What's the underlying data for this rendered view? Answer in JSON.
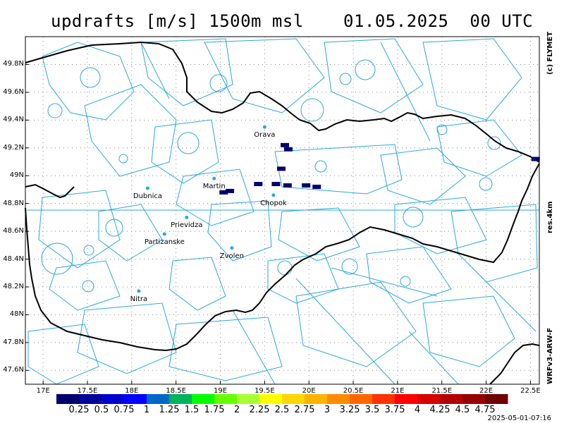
{
  "title": {
    "variable": "updrafts [m/s] 1500m msl",
    "datetime": "01.05.2025  00 UTC"
  },
  "side_labels": {
    "copyright": "(c) FLYMET",
    "resolution": "res.4km",
    "model": "WRFv3-ARW-F"
  },
  "timestamp": "2025-05-01-07:16",
  "map": {
    "lon_range": [
      16.8,
      22.6
    ],
    "lat_range": [
      47.5,
      50.0
    ],
    "lat_ticks": [
      {
        "value": 49.8,
        "label": "49.8N"
      },
      {
        "value": 49.6,
        "label": "49.6N"
      },
      {
        "value": 49.4,
        "label": "49.4N"
      },
      {
        "value": 49.2,
        "label": "49.2N"
      },
      {
        "value": 49.0,
        "label": "49N"
      },
      {
        "value": 48.8,
        "label": "48.8N"
      },
      {
        "value": 48.6,
        "label": "48.6N"
      },
      {
        "value": 48.4,
        "label": "48.4N"
      },
      {
        "value": 48.2,
        "label": "48.2N"
      },
      {
        "value": 48.0,
        "label": "48N"
      },
      {
        "value": 47.8,
        "label": "47.8N"
      },
      {
        "value": 47.6,
        "label": "47.6N"
      }
    ],
    "lon_ticks": [
      {
        "value": 17.0,
        "label": "17E"
      },
      {
        "value": 17.5,
        "label": "17.5E"
      },
      {
        "value": 18.0,
        "label": "18E"
      },
      {
        "value": 18.5,
        "label": "18.5E"
      },
      {
        "value": 19.0,
        "label": "19E"
      },
      {
        "value": 19.5,
        "label": "19.5E"
      },
      {
        "value": 20.0,
        "label": "20E"
      },
      {
        "value": 20.5,
        "label": "20.5E"
      },
      {
        "value": 21.0,
        "label": "21E"
      },
      {
        "value": 21.5,
        "label": "21.5E"
      },
      {
        "value": 22.0,
        "label": "22E"
      },
      {
        "value": 22.5,
        "label": "22.5E"
      }
    ],
    "cities": [
      {
        "name": "Orava",
        "lon": 19.5,
        "lat": 49.35
      },
      {
        "name": "Martin",
        "lon": 18.93,
        "lat": 48.98
      },
      {
        "name": "Dubnica",
        "lon": 18.18,
        "lat": 48.91
      },
      {
        "name": "Chopok",
        "lon": 19.6,
        "lat": 48.86
      },
      {
        "name": "Prievidza",
        "lon": 18.62,
        "lat": 48.7
      },
      {
        "name": "Partizanske",
        "lon": 18.37,
        "lat": 48.58
      },
      {
        "name": "Zvolen",
        "lon": 19.13,
        "lat": 48.48
      },
      {
        "name": "Nitra",
        "lon": 18.08,
        "lat": 48.17
      }
    ],
    "grid": "dotted",
    "colors": {
      "border": "#000000",
      "topography": "#29a8e0",
      "grid": "#888888"
    }
  },
  "updraft_cells": [
    {
      "lon": 19.62,
      "lat": 48.94,
      "value": 0.25
    },
    {
      "lon": 19.75,
      "lat": 48.93,
      "value": 0.25
    },
    {
      "lon": 20.08,
      "lat": 48.92,
      "value": 0.25
    },
    {
      "lon": 19.42,
      "lat": 48.94,
      "value": 0.25
    },
    {
      "lon": 19.68,
      "lat": 49.05,
      "value": 0.25
    },
    {
      "lon": 19.96,
      "lat": 48.93,
      "value": 0.25
    },
    {
      "lon": 19.1,
      "lat": 48.89,
      "value": 0.25
    },
    {
      "lon": 19.03,
      "lat": 48.88,
      "value": 0.25
    },
    {
      "lon": 19.76,
      "lat": 49.19,
      "value": 0.25
    },
    {
      "lon": 19.72,
      "lat": 49.22,
      "value": 0.25
    },
    {
      "lon": 22.55,
      "lat": 49.12,
      "value": 0.25
    }
  ],
  "legend": {
    "values": [
      "0.25",
      "0.5",
      "0.75",
      "1",
      "1.25",
      "1.5",
      "1.75",
      "2",
      "2.25",
      "2.5",
      "2.75",
      "3",
      "3.25",
      "3.5",
      "3.75",
      "4",
      "4.25",
      "4.5",
      "4.75"
    ],
    "colors": [
      "#00006e",
      "#00009b",
      "#0000cd",
      "#0000ff",
      "#0066c8",
      "#00b45a",
      "#00ff00",
      "#66ff00",
      "#aaff33",
      "#ffff00",
      "#ffd700",
      "#ffb300",
      "#ff8c00",
      "#ff6600",
      "#ff3300",
      "#ff0000",
      "#d70000",
      "#b40000",
      "#960000",
      "#6e0000"
    ]
  }
}
